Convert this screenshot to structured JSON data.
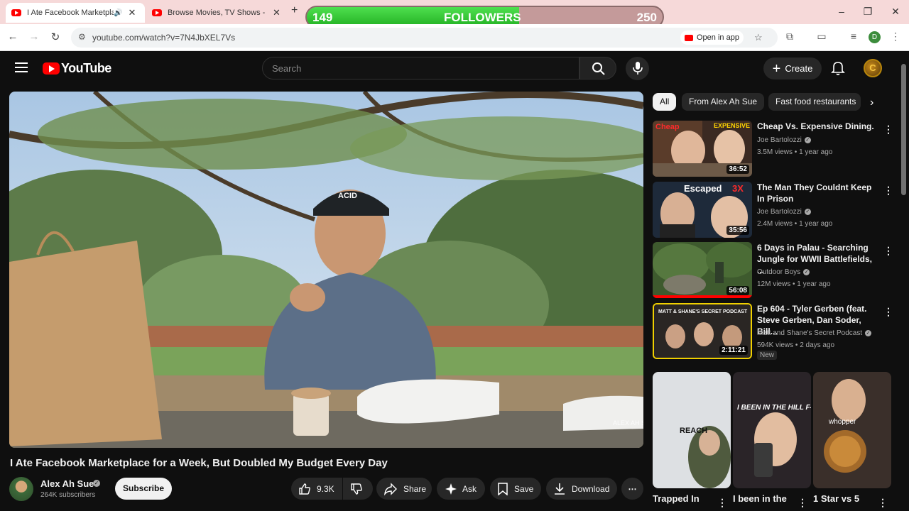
{
  "browser": {
    "tabs": [
      {
        "title": "I Ate Facebook Marketplace for a"
      },
      {
        "title": "Browse Movies, TV Shows - yFlix"
      }
    ],
    "url": "youtube.com/watch?v=7N4JbXEL7Vs",
    "open_in_app": "Open in app",
    "profile_initial": "D"
  },
  "overlay": {
    "left": "149",
    "label": "FOLLOWERS",
    "right": "250",
    "progress": 0.596
  },
  "header": {
    "logo": "YouTube",
    "search_placeholder": "Search",
    "create_label": "Create",
    "avatar_letter": "C"
  },
  "video": {
    "title": "I Ate Facebook Marketplace for a Week, But Doubled My Budget Every Day",
    "channel": "Alex Ah Sue",
    "subscribers": "264K subscribers",
    "subscribe_label": "Subscribe",
    "likes": "9.3K",
    "share_label": "Share",
    "ask_label": "Ask",
    "save_label": "Save",
    "download_label": "Download",
    "watermark": "ALEX AH SUE"
  },
  "chips": [
    "All",
    "From Alex Ah Sue",
    "Fast food restaurants"
  ],
  "recommendations": [
    {
      "title": "Cheap Vs. Expensive Dining.",
      "channel": "Joe Bartolozzi",
      "meta": "3.5M views • 1 year ago",
      "duration": "36:52",
      "thumb_text_a": "Cheap",
      "thumb_text_b": "EXPENSIVE"
    },
    {
      "title": "The Man They Couldnt Keep In Prison",
      "channel": "Joe Bartolozzi",
      "meta": "2.4M views • 1 year ago",
      "duration": "35:56",
      "thumb_text_a": "Escaped",
      "thumb_text_b": "3X"
    },
    {
      "title": "6 Days in Palau - Searching Jungle for WWII Battlefields, ...",
      "channel": "Outdoor Boys",
      "meta": "12M views • 1 year ago",
      "duration": "56:08"
    },
    {
      "title": "Ep 604 - Tyler Gerben (feat. Steve Gerben, Dan Soder, Bill...",
      "channel": "Matt and Shane's Secret Podcast",
      "meta": "594K views • 2 days ago",
      "duration": "2:11:21",
      "badge": "New",
      "thumb_text_a": "MATT & SHANE'S SECRET PODCAST"
    }
  ],
  "shorts": [
    {
      "title": "Trapped In",
      "thumb_text": "REACH"
    },
    {
      "title": "I been in the",
      "thumb_text": "I BEEN IN THE HILL F-"
    },
    {
      "title": "1 Star vs 5",
      "thumb_text": "whopper"
    }
  ]
}
